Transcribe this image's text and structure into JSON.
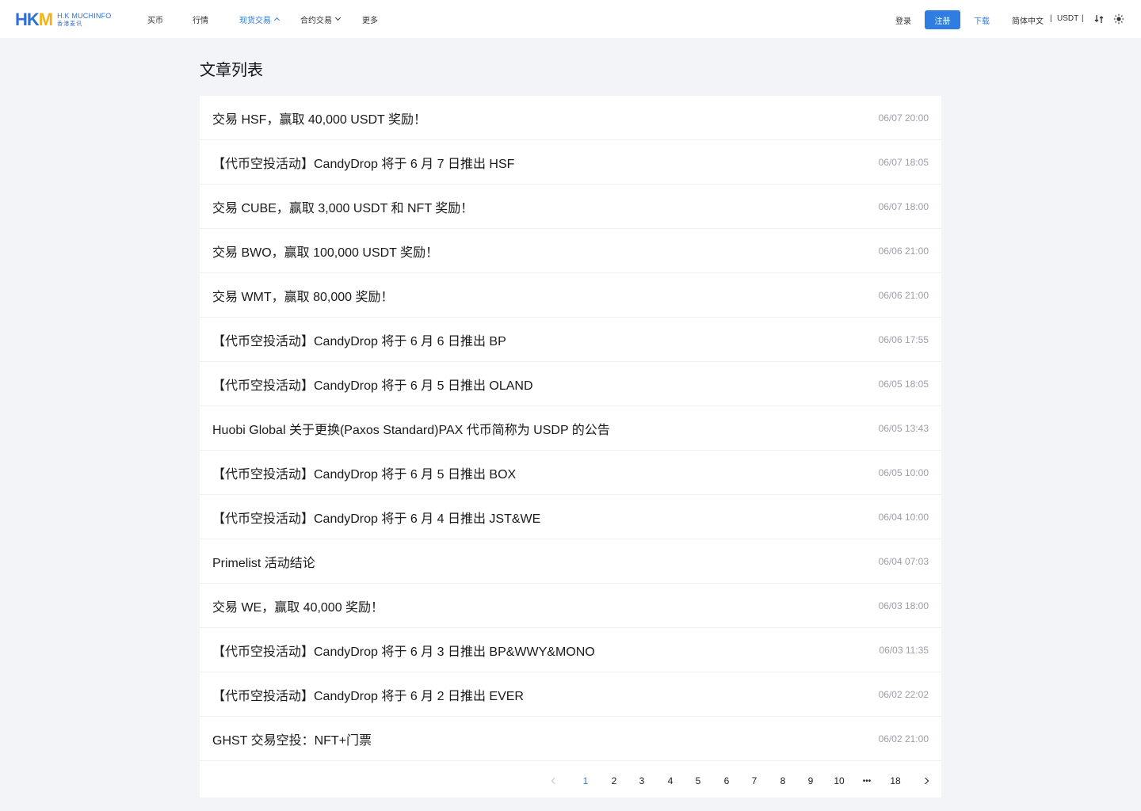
{
  "header": {
    "logo": {
      "mark_part1": "HK",
      "mark_part2": "M",
      "name_en": "H.K MUCHINFO",
      "name_cn": "香港麦讯"
    },
    "nav": [
      {
        "label": "买币"
      },
      {
        "label": "行情"
      },
      {
        "label": "现货交易",
        "active": true,
        "dropdown": "up"
      },
      {
        "label": "合约交易",
        "dropdown": "down"
      },
      {
        "label": "更多"
      }
    ],
    "login": "登录",
    "register": "注册",
    "download": "下载",
    "language": "简体中文",
    "separator": "|",
    "currency": "USDT",
    "icons": [
      "swap-icon",
      "sun-icon"
    ]
  },
  "colors": {
    "accent": "#2f7de1",
    "page_bg": "#f2f4f7",
    "time_text": "#9aa0a6"
  },
  "page_title": "文章列表",
  "articles": [
    {
      "title": "交易 HSF，赢取 40,000 USDT 奖励！",
      "time": "06/07 20:00"
    },
    {
      "title": "【代币空投活动】CandyDrop 将于 6 月 7 日推出 HSF",
      "time": "06/07 18:05"
    },
    {
      "title": "交易 CUBE，赢取 3,000 USDT 和 NFT 奖励！",
      "time": "06/07 18:00"
    },
    {
      "title": "交易 BWO，赢取 100,000 USDT 奖励！",
      "time": "06/06 21:00"
    },
    {
      "title": "交易 WMT，赢取 80,000 奖励！",
      "time": "06/06 21:00"
    },
    {
      "title": "【代币空投活动】CandyDrop 将于 6 月 6 日推出 BP",
      "time": "06/06 17:55"
    },
    {
      "title": "【代币空投活动】CandyDrop 将于 6 月 5 日推出 OLAND",
      "time": "06/05 18:05"
    },
    {
      "title": "Huobi Global 关于更换(Paxos Standard)PAX 代币简称为 USDP 的公告",
      "time": "06/05 13:43"
    },
    {
      "title": "【代币空投活动】CandyDrop 将于 6 月 5 日推出 BOX",
      "time": "06/05 10:00"
    },
    {
      "title": "【代币空投活动】CandyDrop 将于 6 月 4 日推出 JST&WE",
      "time": "06/04 10:00"
    },
    {
      "title": "Primelist 活动结论",
      "time": "06/04 07:03"
    },
    {
      "title": "交易 WE，赢取 40,000 奖励！",
      "time": "06/03 18:00"
    },
    {
      "title": "【代币空投活动】CandyDrop 将于 6 月 3 日推出 BP&WWY&MONO",
      "time": "06/03 11:35"
    },
    {
      "title": "【代币空投活动】CandyDrop 将于 6 月 2 日推出 EVER",
      "time": "06/02 22:02"
    },
    {
      "title": "GHST 交易空投：NFT+门票",
      "time": "06/02 21:00"
    }
  ],
  "pagination": {
    "current": 1,
    "pages": [
      "1",
      "2",
      "3",
      "4",
      "5",
      "6",
      "7",
      "8",
      "9",
      "10",
      "•••",
      "18"
    ],
    "prev_icon": "chevron-left-icon",
    "next_icon": "chevron-right-icon"
  }
}
